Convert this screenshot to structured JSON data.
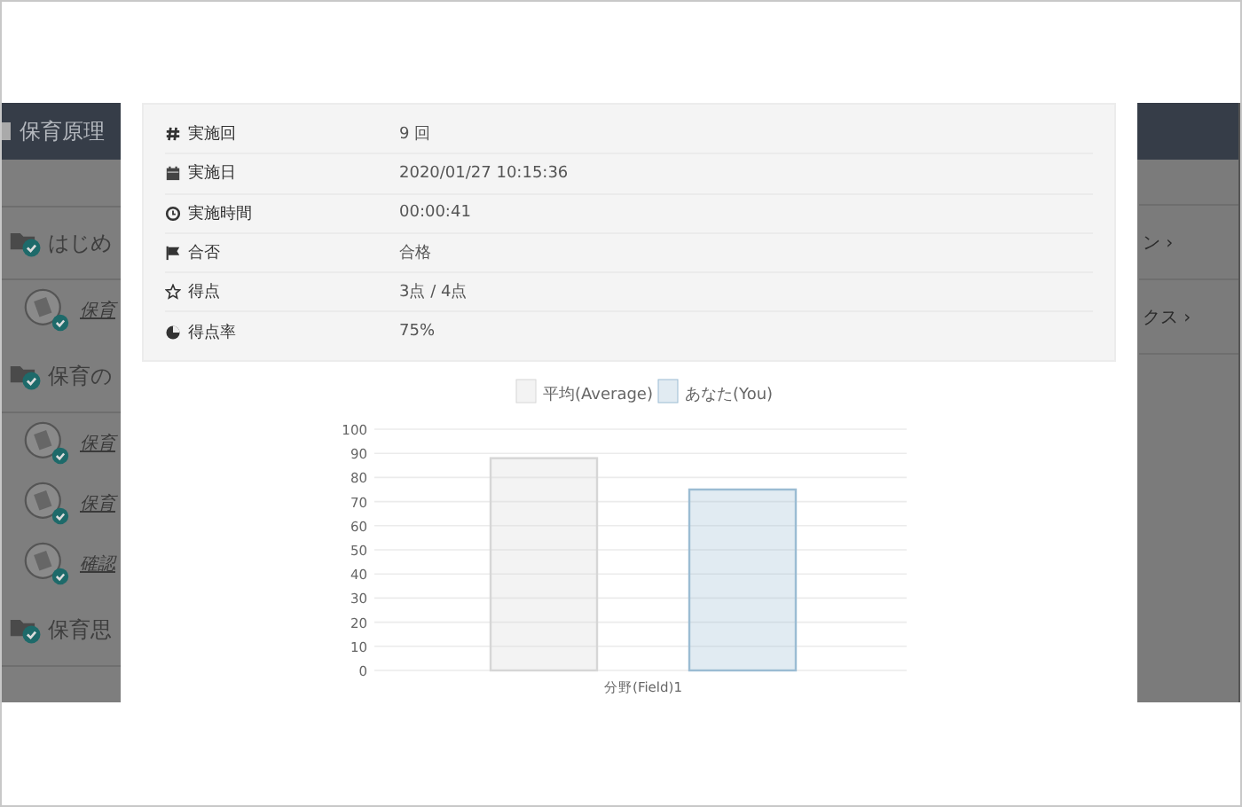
{
  "app_header": {
    "title": "保育原理"
  },
  "sidebar": {
    "sections": [
      {
        "title": "はじめ",
        "items": [
          {
            "label": "保育",
            "done": true
          }
        ]
      },
      {
        "title": "保育の",
        "items": [
          {
            "label": "保育",
            "done": true
          },
          {
            "label": "保育",
            "done": true
          },
          {
            "label": "確認",
            "done": true
          }
        ]
      },
      {
        "title": "保育思"
      }
    ]
  },
  "right_menu": [
    {
      "label": "ン ›"
    },
    {
      "label": "クス ›"
    }
  ],
  "modal": {
    "details": [
      {
        "label": "実施回",
        "value": "9 回"
      },
      {
        "label": "実施日",
        "value": "2020/01/27 10:15:36"
      },
      {
        "label": "実施時間",
        "value": "00:00:41"
      },
      {
        "label": "合否",
        "value": "合格"
      },
      {
        "label": "得点",
        "value": "3点 / 4点"
      },
      {
        "label": "得点率",
        "value": "75%"
      }
    ],
    "chart_data": {
      "type": "bar",
      "categories": [
        "分野(Field)1"
      ],
      "series": [
        {
          "name": "平均(Average)",
          "color": "#d6d6d6",
          "values": [
            88
          ]
        },
        {
          "name": "あなた(You)",
          "color": "#9bbcd3",
          "values": [
            75
          ]
        }
      ],
      "ylim": [
        0,
        100
      ],
      "yticks": [
        0,
        10,
        20,
        30,
        40,
        50,
        60,
        70,
        80,
        90,
        100
      ],
      "grid": true,
      "legend": true
    }
  }
}
